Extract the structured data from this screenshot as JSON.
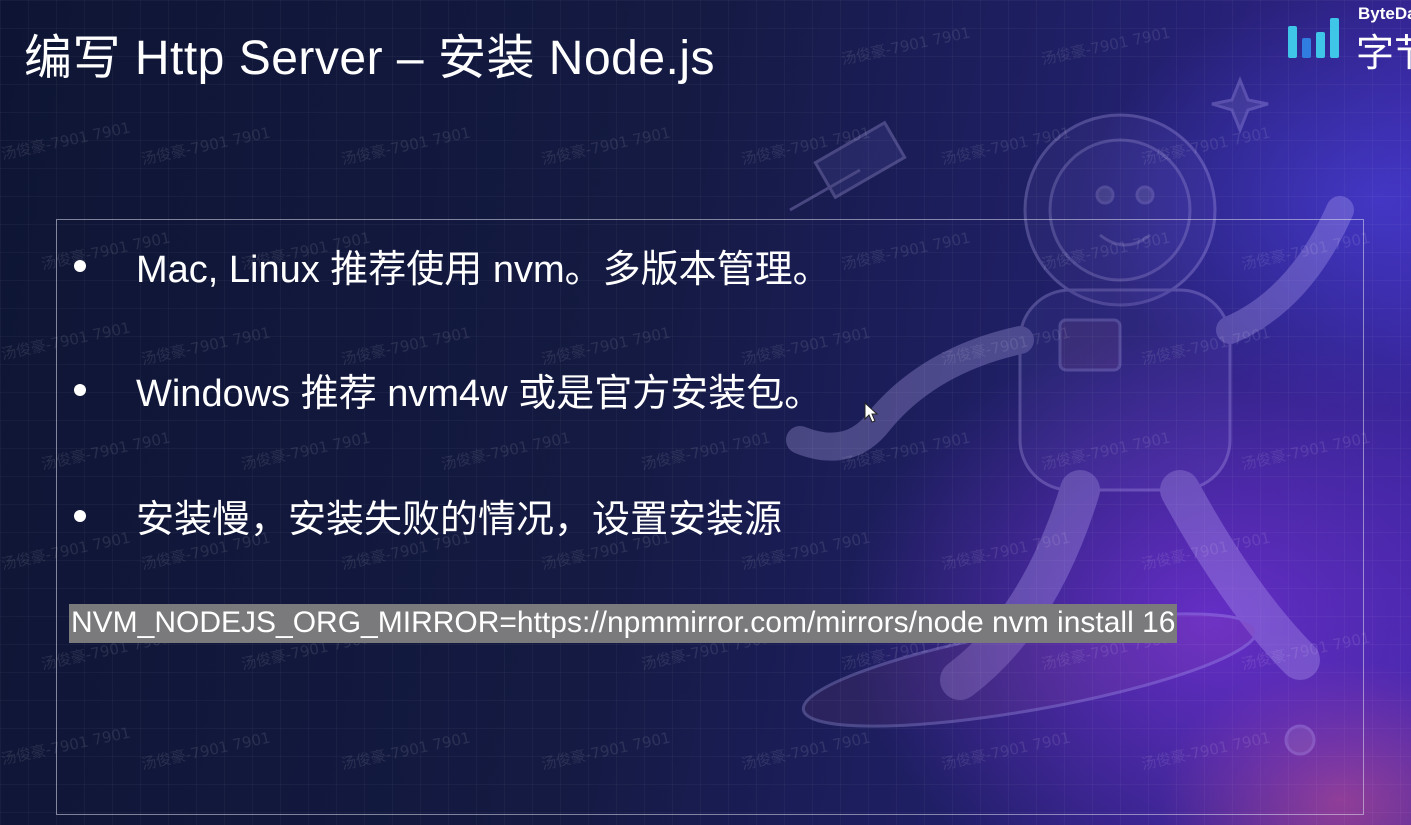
{
  "slide": {
    "title": "编写 Http Server – 安装 Node.js"
  },
  "brand": {
    "small_text": "ByteDa",
    "big_text": "字节",
    "logo_icon": "bytedance-logo-bars-icon"
  },
  "bullets": [
    {
      "text": "Mac, Linux 推荐使用 nvm。多版本管理。"
    },
    {
      "text": "Windows 推荐 nvm4w 或是官方安装包。"
    },
    {
      "text": "安装慢，安装失败的情况，设置安装源"
    }
  ],
  "code": {
    "text": "NVM_NODEJS_ORG_MIRROR=https://npmmirror.com/mirrors/node nvm install 16"
  },
  "watermark": {
    "text": "汤俊豪-7901 7901"
  },
  "colors": {
    "background_dark": "#0e1534",
    "background_purple": "#3b25a0",
    "code_highlight": "#7a7a7d",
    "logo_blue": "#3ec5e8",
    "text": "#ffffff"
  }
}
